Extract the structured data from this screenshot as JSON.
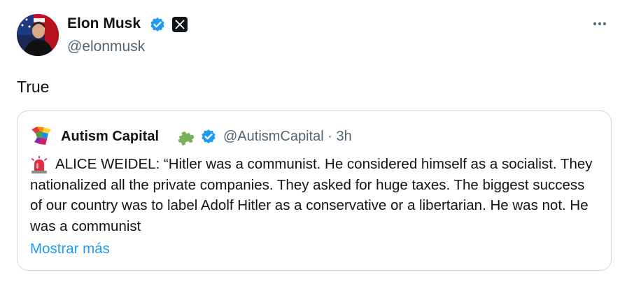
{
  "author": {
    "name": "Elon Musk",
    "handle": "@elonmusk",
    "verified_color": "#1d9bf0",
    "affiliation_icon": "x-logo-icon"
  },
  "tweet": {
    "text": "True"
  },
  "quoted": {
    "name": "Autism Capital",
    "name_emoji": "puzzle-piece-icon",
    "handle_time": "@AutismCapital · 3h",
    "lead_icon": "police-light-icon",
    "text": "ALICE WEIDEL: “Hitler was a communist. He considered himself as a socialist. They nationalized all the private companies. They asked for huge taxes. The biggest success of our country was to label Adolf Hitler as a conservative or a libertarian. He was not. He was a communist",
    "show_more": "Mostrar más"
  },
  "colors": {
    "text": "#0f1419",
    "secondary": "#536471",
    "link": "#1d9bf0",
    "border": "#cfd9de"
  }
}
